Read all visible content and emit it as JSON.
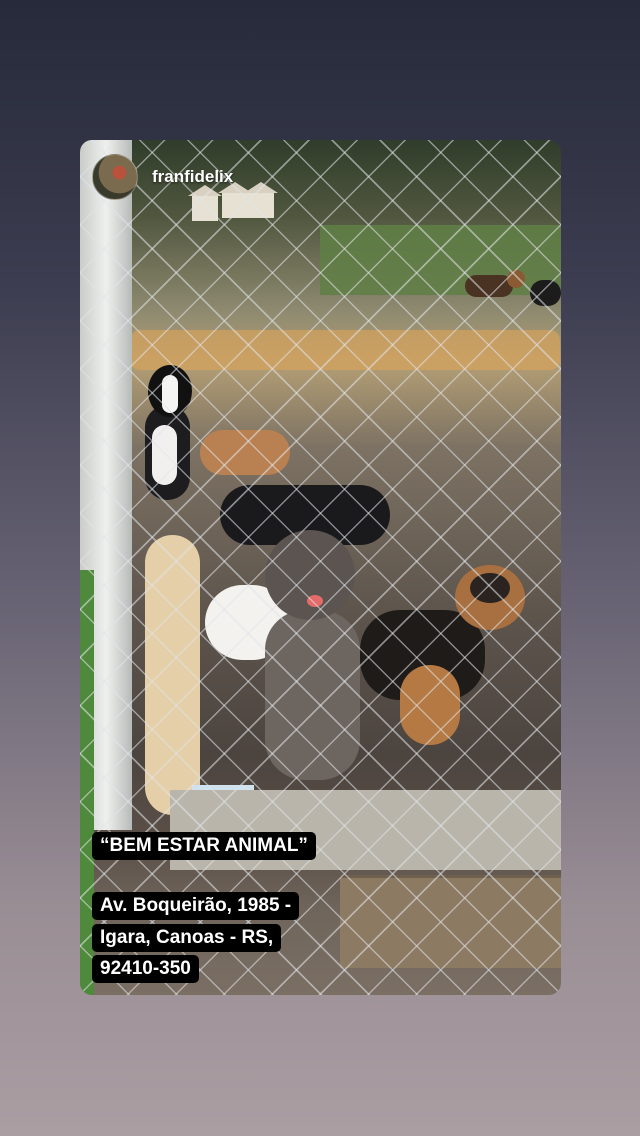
{
  "story": {
    "username": "franfidelix",
    "title": "“BEM ESTAR ANIMAL”",
    "address_lines": [
      "Av. Boqueirão, 1985 -",
      "Igara, Canoas - RS,",
      "92410-350"
    ]
  },
  "colors": {
    "background_top": "#262a3a",
    "background_bottom": "#aa9ea3",
    "sticker_bg": "#000000",
    "sticker_text": "#ffffff"
  }
}
